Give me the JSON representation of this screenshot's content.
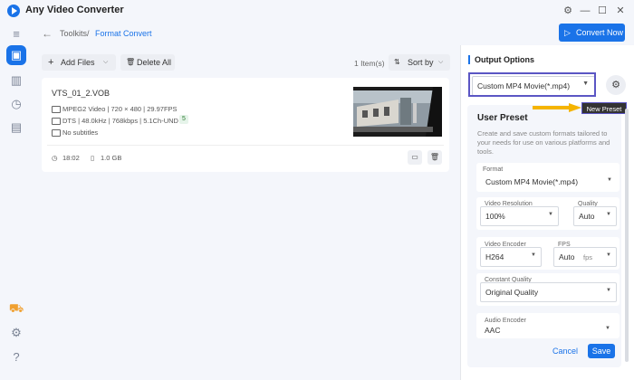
{
  "app": {
    "title": "Any Video Converter"
  },
  "window": {
    "menu_icon": "⚙",
    "minimize": "—",
    "maximize": "☐",
    "close": "✕"
  },
  "breadcrumb": {
    "root": "Toolkits",
    "separator": "/",
    "current": "Format Convert"
  },
  "header": {
    "convert_label": "Convert Now"
  },
  "toolbar": {
    "add_files": "Add Files",
    "delete_all": "Delete All",
    "items_count": "1 Item(s)",
    "sort_by": "Sort by"
  },
  "file": {
    "name": "VTS_01_2.VOB",
    "video": "MPEG2 Video | 720 × 480 | 29.97FPS",
    "audio": "DTS | 48.0kHz | 768kbps | 5.1Ch-UND",
    "audio_tracks": "5",
    "subtitles": "No subtitles",
    "duration": "18:02",
    "size": "1.0 GB"
  },
  "output": {
    "title": "Output Options",
    "preset_value": "Custom MP4 Movie(*.mp4)",
    "tooltip": "New Preset"
  },
  "user_preset": {
    "title": "User Preset",
    "description": "Create and save custom formats tailored to your needs for use on various platforms and tools.",
    "format_label": "Format",
    "format_value": "Custom MP4 Movie(*.mp4)",
    "resolution_label": "Video Resolution",
    "resolution_value": "100%",
    "quality_label": "Quality",
    "quality_value": "Auto",
    "encoder_label": "Video Encoder",
    "encoder_value": "H264",
    "fps_label": "FPS",
    "fps_value": "Auto",
    "fps_unit": "fps",
    "constant_quality_label": "Constant Quality",
    "constant_quality_value": "Original Quality",
    "audio_encoder_label": "Audio Encoder",
    "audio_encoder_value": "AAC",
    "cancel": "Cancel",
    "save": "Save"
  },
  "colors": {
    "accent": "#1a73e8",
    "highlight": "#5b56c4",
    "arrow": "#f5b400"
  }
}
